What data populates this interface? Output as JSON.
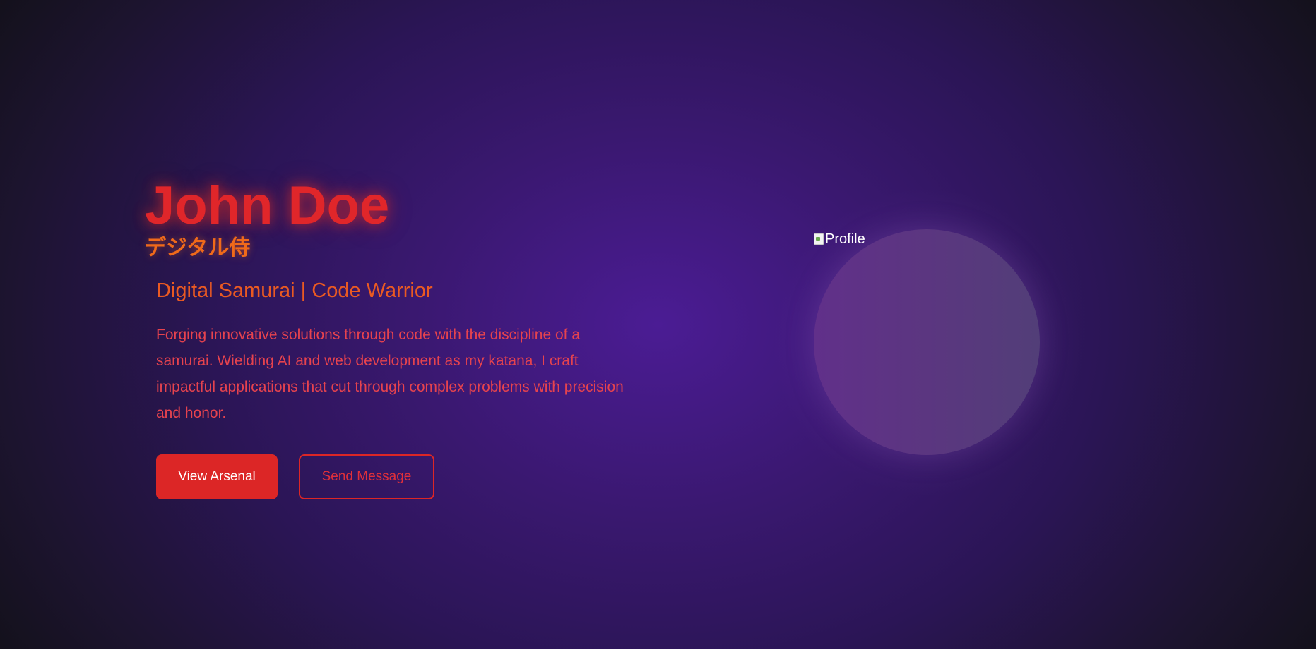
{
  "hero": {
    "name": "John Doe",
    "japanese_title": "デジタル侍",
    "tagline": "Digital Samurai | Code Warrior",
    "bio": "Forging innovative solutions through code with the discipline of a samurai. Wielding AI and web development as my katana, I craft impactful applications that cut through complex problems with precision and honor.",
    "buttons": {
      "primary_label": "View Arsenal",
      "secondary_label": "Send Message"
    }
  },
  "profile": {
    "image_alt": "Profile",
    "icon": "broken-image-icon"
  },
  "colors": {
    "accent_red": "#dc2626",
    "accent_orange": "#f06a1a",
    "background_purple": "#4b1c94"
  }
}
